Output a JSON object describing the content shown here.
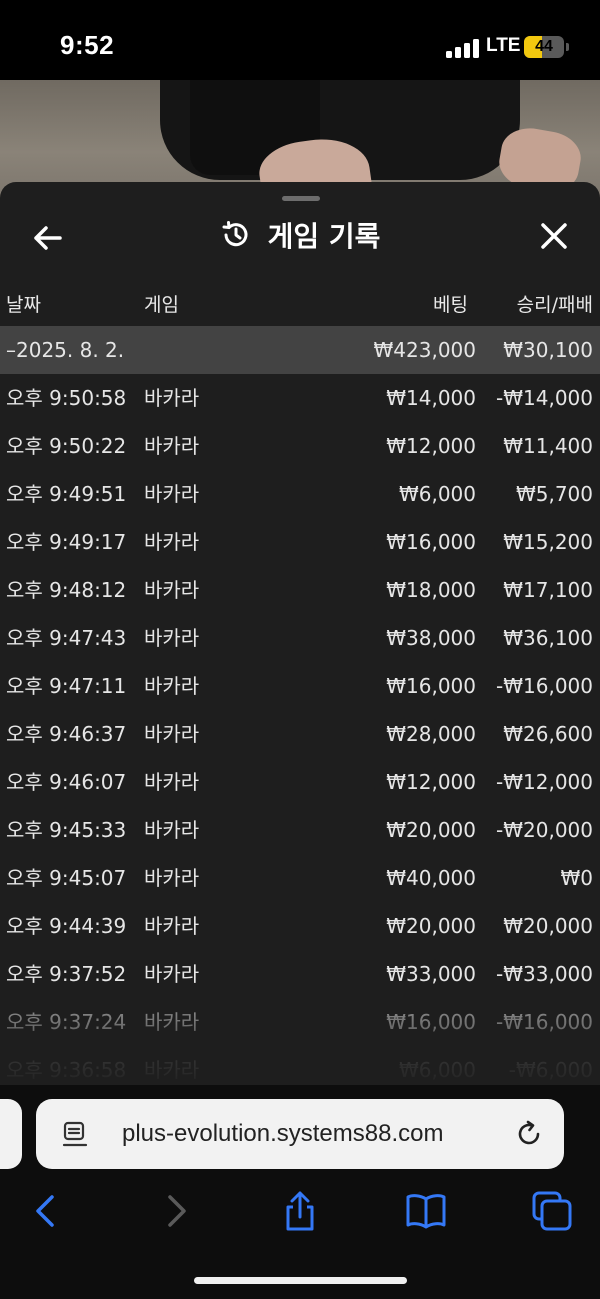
{
  "status": {
    "time": "9:52",
    "network": "LTE",
    "battery": "44",
    "battery_level": 0.44
  },
  "sheet": {
    "title": "게임 기록",
    "icons": {
      "back": "arrow-left-icon",
      "history": "history-icon",
      "close": "close-icon"
    },
    "columns": {
      "date": "날짜",
      "game": "게임",
      "bet": "베팅",
      "winloss": "승리/패배"
    },
    "date_group": {
      "label": "–2025. 8. 2.",
      "bet_total": "₩423,000",
      "winloss_total": "₩30,100"
    },
    "rows": [
      {
        "time": "오후 9:50:58",
        "game": "바카라",
        "bet": "₩14,000",
        "winloss": "-₩14,000"
      },
      {
        "time": "오후 9:50:22",
        "game": "바카라",
        "bet": "₩12,000",
        "winloss": "₩11,400"
      },
      {
        "time": "오후 9:49:51",
        "game": "바카라",
        "bet": "₩6,000",
        "winloss": "₩5,700"
      },
      {
        "time": "오후 9:49:17",
        "game": "바카라",
        "bet": "₩16,000",
        "winloss": "₩15,200"
      },
      {
        "time": "오후 9:48:12",
        "game": "바카라",
        "bet": "₩18,000",
        "winloss": "₩17,100"
      },
      {
        "time": "오후 9:47:43",
        "game": "바카라",
        "bet": "₩38,000",
        "winloss": "₩36,100"
      },
      {
        "time": "오후 9:47:11",
        "game": "바카라",
        "bet": "₩16,000",
        "winloss": "-₩16,000"
      },
      {
        "time": "오후 9:46:37",
        "game": "바카라",
        "bet": "₩28,000",
        "winloss": "₩26,600"
      },
      {
        "time": "오후 9:46:07",
        "game": "바카라",
        "bet": "₩12,000",
        "winloss": "-₩12,000"
      },
      {
        "time": "오후 9:45:33",
        "game": "바카라",
        "bet": "₩20,000",
        "winloss": "-₩20,000"
      },
      {
        "time": "오후 9:45:07",
        "game": "바카라",
        "bet": "₩40,000",
        "winloss": "₩0"
      },
      {
        "time": "오후 9:44:39",
        "game": "바카라",
        "bet": "₩20,000",
        "winloss": "₩20,000"
      },
      {
        "time": "오후 9:37:52",
        "game": "바카라",
        "bet": "₩33,000",
        "winloss": "-₩33,000"
      },
      {
        "time": "오후 9:37:24",
        "game": "바카라",
        "bet": "₩16,000",
        "winloss": "-₩16,000"
      },
      {
        "time": "오후 9:36:58",
        "game": "바카라",
        "bet": "₩6,000",
        "winloss": "-₩6,000"
      }
    ]
  },
  "browser": {
    "url": "plus-evolution.systems88.com",
    "icons": {
      "reader": "reader-mode-icon",
      "reload": "reload-icon",
      "back": "chevron-left-icon",
      "forward": "chevron-right-icon",
      "share": "share-icon",
      "bookmarks": "bookmarks-icon",
      "tabs": "tabs-icon"
    },
    "colors": {
      "accent": "#3478f6",
      "disabled": "#5a5a5a"
    }
  }
}
